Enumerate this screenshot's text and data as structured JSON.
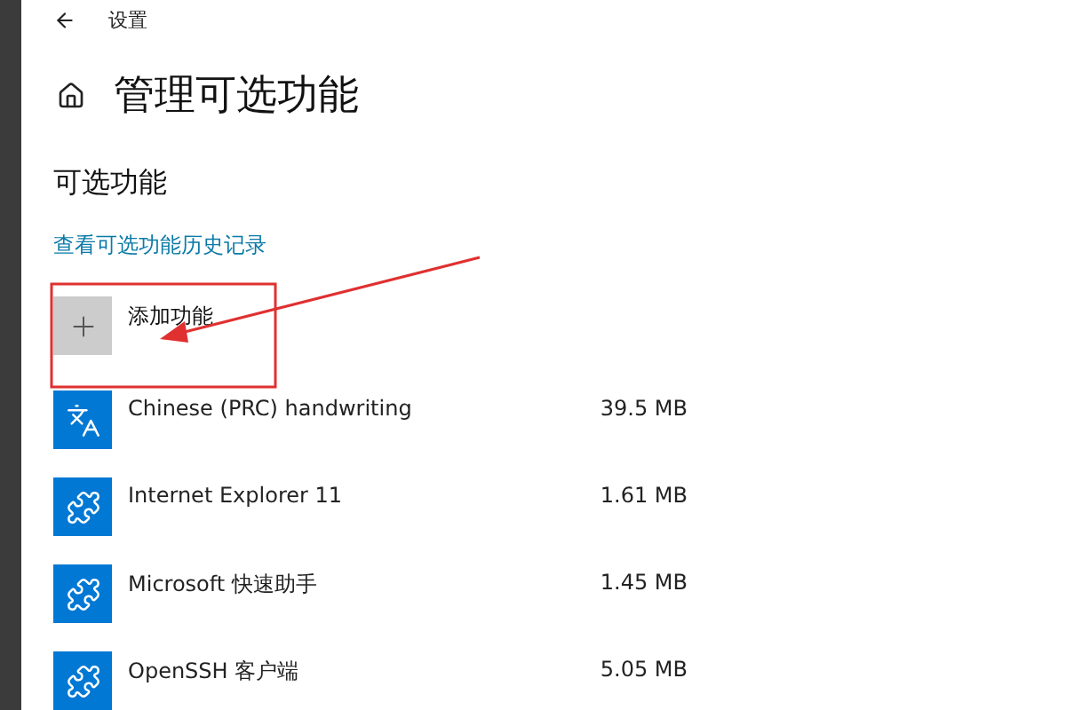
{
  "window": {
    "title": "设置"
  },
  "page": {
    "title": "管理可选功能"
  },
  "section": {
    "title": "可选功能",
    "history_link": "查看可选功能历史记录",
    "add_button": "添加功能"
  },
  "features": [
    {
      "kind": "language",
      "name": "Chinese (PRC) handwriting",
      "size": "39.5 MB"
    },
    {
      "kind": "puzzle",
      "name": "Internet Explorer 11",
      "size": "1.61 MB"
    },
    {
      "kind": "puzzle",
      "name": "Microsoft 快速助手",
      "size": "1.45 MB"
    },
    {
      "kind": "puzzle",
      "name": "OpenSSH 客户端",
      "size": "5.05 MB"
    }
  ]
}
